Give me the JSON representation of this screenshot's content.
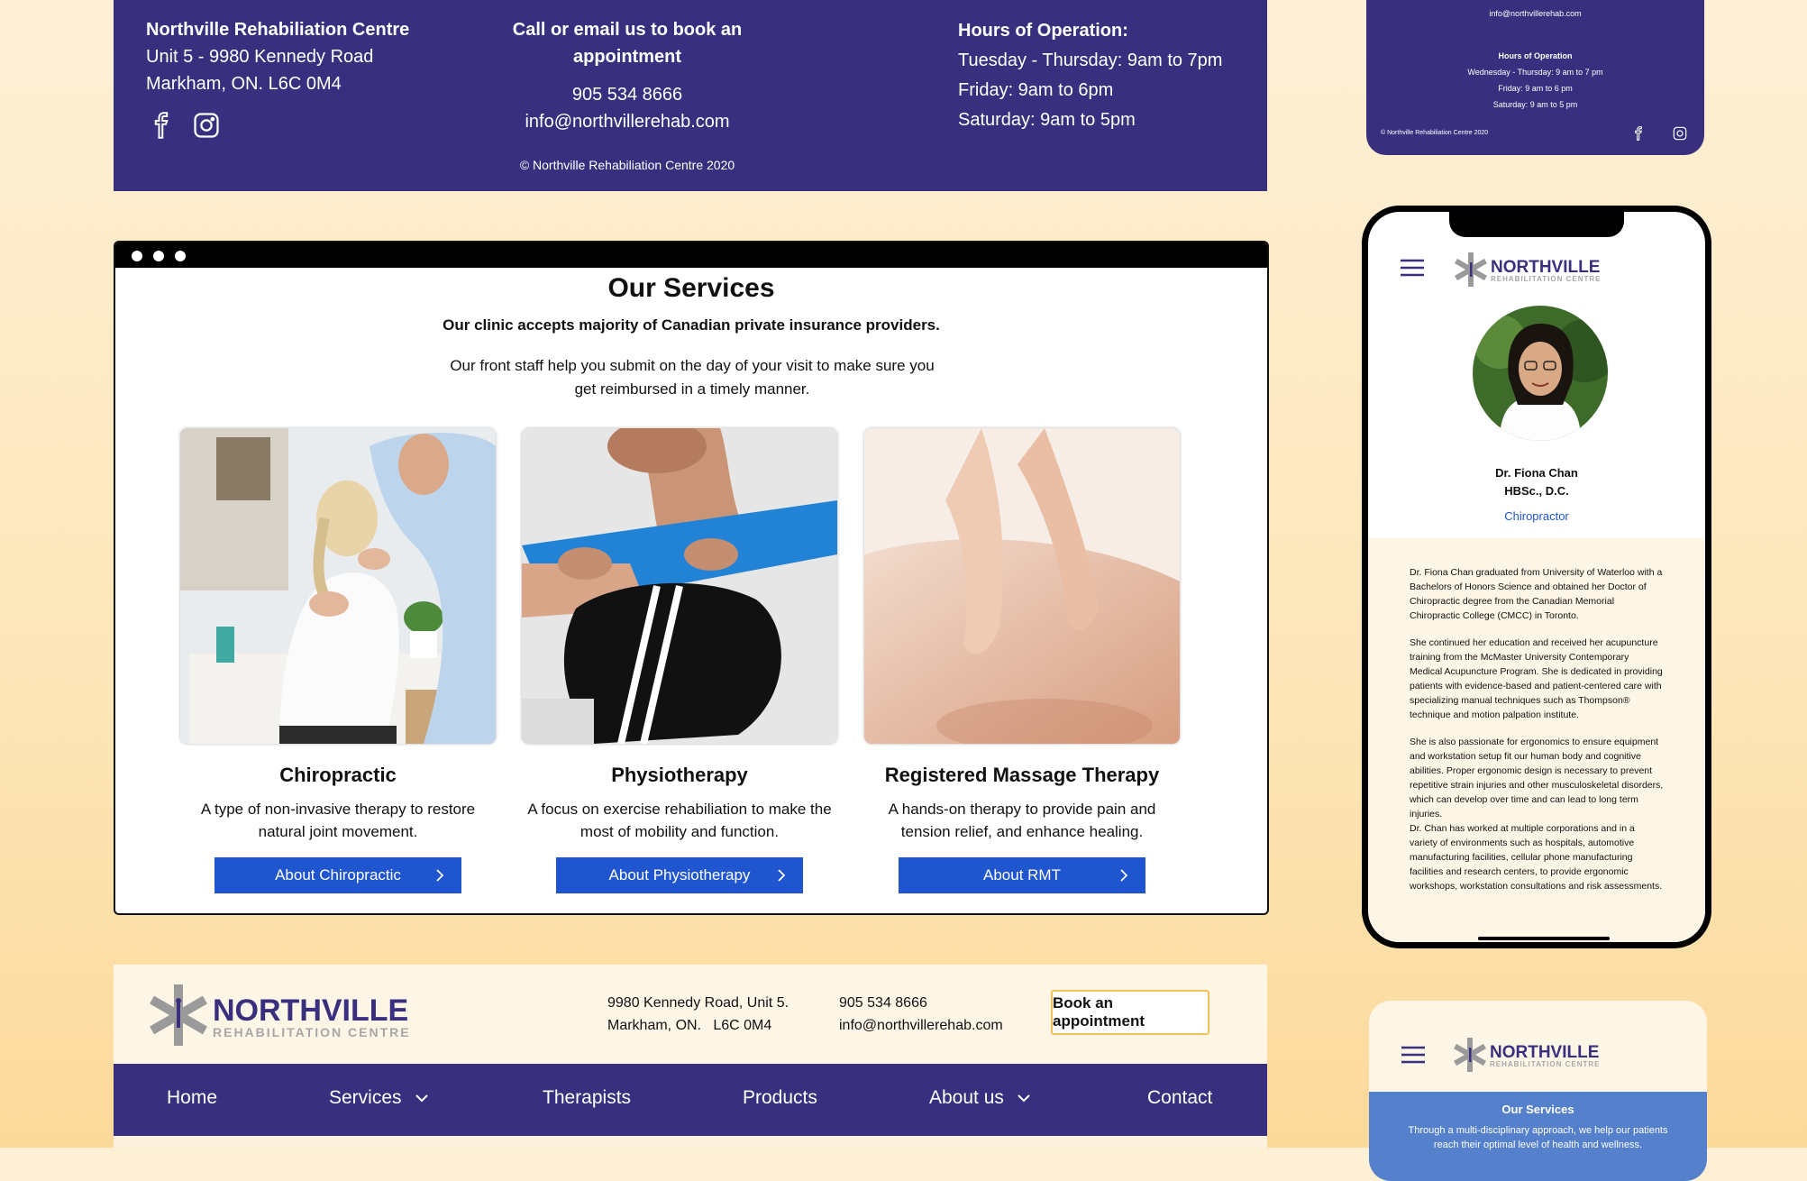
{
  "colors": {
    "brand_purple": "#38307e",
    "button_blue": "#1f55cf",
    "cream": "#fdf6e6",
    "accent_gold": "#f2c15a",
    "band_blue": "#5480cc"
  },
  "footer": {
    "name": "Northville Rehabiliation Centre",
    "address_line1": "Unit 5 - 9980 Kennedy Road",
    "address_line2": "Markham, ON. L6C 0M4",
    "book_heading": "Call or email us to book an appointment",
    "phone": "905 534 8666",
    "email": "info@northvillerehab.com",
    "copyright": "Northville Rehabiliation Centre 2020",
    "hours_heading": "Hours of Operation:",
    "hours": [
      "Tuesday - Thursday: 9am to 7pm",
      "Friday: 9am to 6pm",
      "Saturday: 9am to 5pm"
    ],
    "social_icons": [
      "facebook-icon",
      "instagram-icon"
    ]
  },
  "services": {
    "title": "Our Services",
    "subtitle": "Our clinic accepts majority of Canadian private insurance providers.",
    "desc": "Our front staff help you submit on the day of your visit to make sure you get reimbursed in a timely manner.",
    "cards": [
      {
        "title": "Chiropractic",
        "text": "A type of non-invasive therapy to restore natural joint movement.",
        "button": "About Chiropractic"
      },
      {
        "title": "Physiotherapy",
        "text": "A focus on exercise rehabiliation to make the most of mobility and function.",
        "button": "About Physiotherapy"
      },
      {
        "title": "Registered Massage Therapy",
        "text": "A hands-on therapy to provide pain and tension relief, and enhance healing.",
        "button": "About RMT"
      }
    ]
  },
  "header": {
    "logo_main": "NORTHVILLE",
    "logo_sub": "REHABILITATION CENTRE",
    "address_line1": "9980 Kennedy Road, Unit 5.",
    "address_line2": "Markham, ON.   L6C 0M4",
    "phone": "905 534 8666",
    "email": "info@northvillerehab.com",
    "book_button": "Book an appointment",
    "nav": [
      {
        "label": "Home"
      },
      {
        "label": "Services"
      },
      {
        "label": "Therapists"
      },
      {
        "label": "Products"
      },
      {
        "label": "About us"
      },
      {
        "label": "Contact"
      }
    ]
  },
  "mini_top": {
    "email": "info@northvillerehab.com",
    "hours_heading": "Hours of Operation",
    "hours": [
      "Wednesday - Thursday: 9 am to 7 pm",
      "Friday: 9 am to 6 pm",
      "Saturday: 9 am to 5 pm"
    ],
    "copyright": "Northville Rehabiliation Centre 2020"
  },
  "phone": {
    "doctor_name": "Dr. Fiona Chan",
    "credentials": "HBSc., D.C.",
    "role": "Chiropractor",
    "bio": [
      "Dr. Fiona Chan graduated from University of Waterloo with a Bachelors of Honors Science and obtained her Doctor of Chiropractic degree from the Canadian Memorial Chiropractic College (CMCC) in Toronto.",
      "She continued her education and received her acupuncture training from the McMaster University Contemporary Medical Acupuncture Program. She is dedicated in providing patients with evidence-based and patient-centered care with specializing manual techniques such as Thompson® technique and motion palpation institute.",
      "She is also passionate for ergonomics to ensure equipment and workstation setup fit our human body and cognitive abilities. Proper ergonomic design is necessary to prevent repetitive strain injuries and other musculoskeletal disorders, which can develop over time and can lead to long term injuries.",
      "Dr. Chan has worked at multiple corporations and in a variety of environments such as hospitals, automotive manufacturing facilities, cellular phone manufacturing facilities and research centers, to provide ergonomic workshops, workstation consultations and risk assessments."
    ]
  },
  "mini_bottom": {
    "section_title": "Our Services",
    "section_desc": "Through a multi-disciplinary approach, we help our patients reach their optimal level of health and wellness."
  }
}
